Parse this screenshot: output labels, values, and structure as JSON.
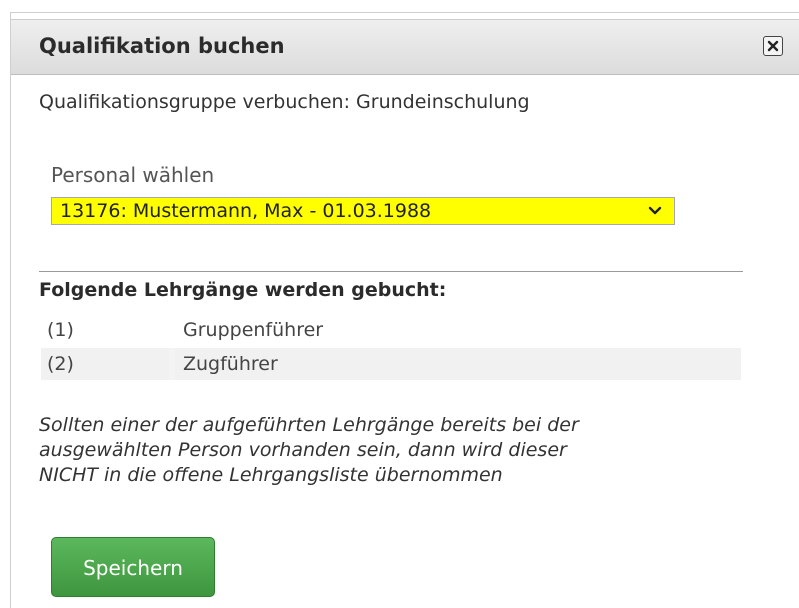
{
  "dialog": {
    "title": "Qualifikation buchen",
    "close_icon": "close-icon",
    "subtitle": "Qualifikationsgruppe verbuchen: Grundeinschulung"
  },
  "personnel": {
    "label": "Personal wählen",
    "selected": "13176: Mustermann, Max - 01.03.1988",
    "highlight_color": "#ffff00"
  },
  "courses": {
    "heading": "Folgende Lehrgänge werden gebucht:",
    "items": [
      {
        "num": "(1)",
        "name": "Gruppenführer"
      },
      {
        "num": "(2)",
        "name": "Zugführer"
      }
    ]
  },
  "note": {
    "lines": [
      "Sollten einer der aufgeführten Lehrgänge bereits bei der",
      "ausgewählten Person vorhanden sein, dann wird dieser",
      "NICHT in die offene Lehrgangsliste übernommen"
    ]
  },
  "actions": {
    "save_label": "Speichern",
    "save_color": "#4cae4c"
  }
}
